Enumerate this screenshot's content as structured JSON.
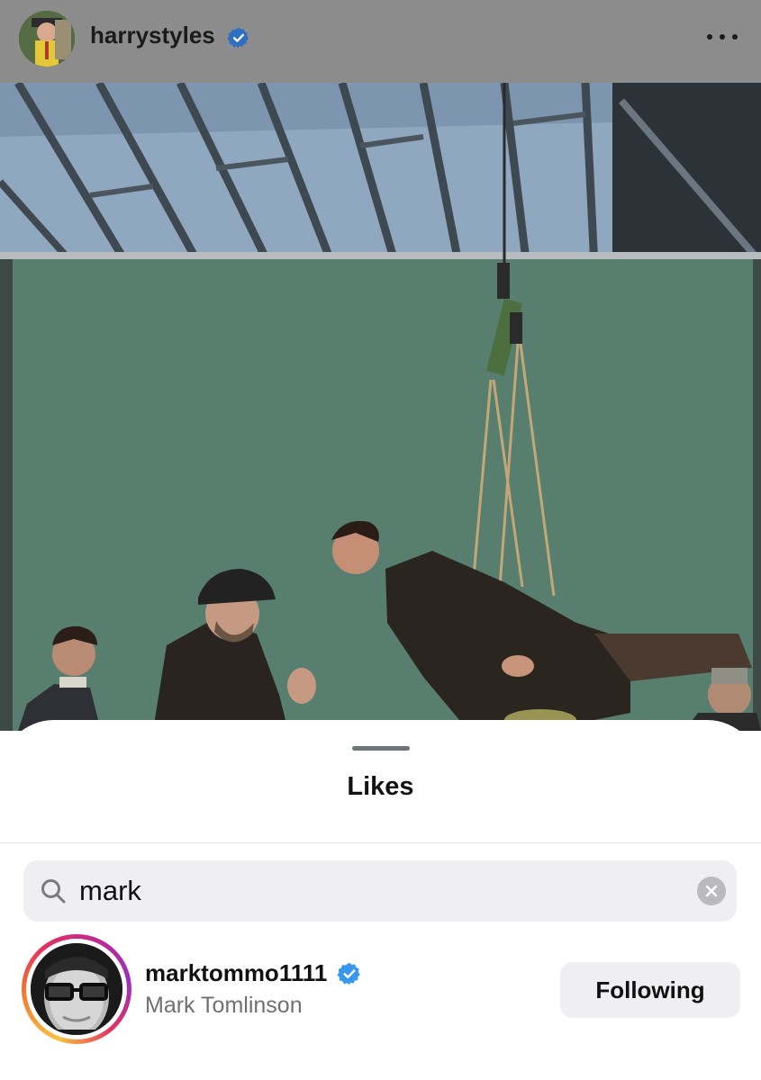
{
  "post": {
    "username": "harrystyles",
    "verified": true,
    "more_icon": "more-horizontal-icon"
  },
  "likes_sheet": {
    "title": "Likes",
    "search": {
      "value": "mark",
      "icon": "search-icon",
      "clear_icon": "clear-icon"
    },
    "results": [
      {
        "username": "marktommo1111",
        "verified": true,
        "full_name": "Mark Tomlinson",
        "button_label": "Following",
        "has_story_ring": true
      }
    ]
  },
  "colors": {
    "verified_blue": "#3897f0",
    "text_primary": "#111111",
    "text_secondary": "#6f6f74",
    "button_bg": "#efeff1",
    "overlay_header": "#8c8c8c"
  }
}
